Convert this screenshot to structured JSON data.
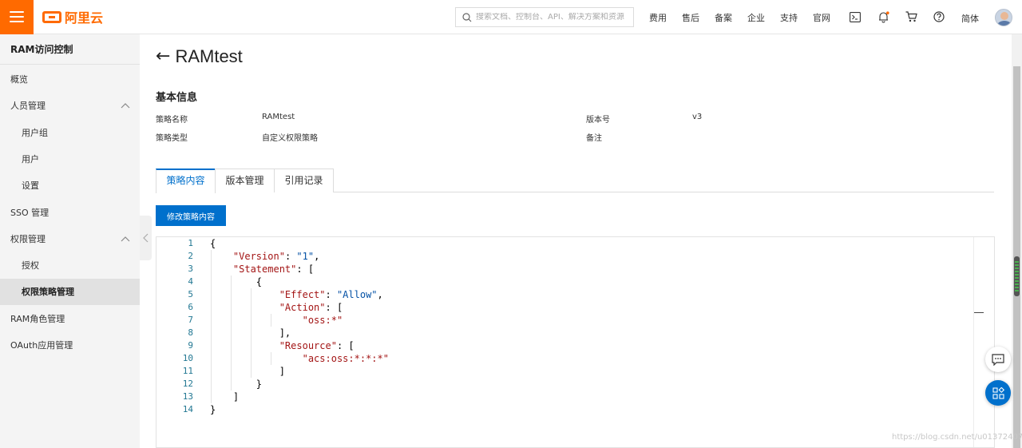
{
  "brand": {
    "name": "阿里云"
  },
  "topbar": {
    "search_placeholder": "搜索文档、控制台、API、解决方案和资源",
    "nav": [
      "费用",
      "售后",
      "备案",
      "企业",
      "支持",
      "官网"
    ],
    "lang": "简体"
  },
  "sidebar": {
    "title": "RAM访问控制",
    "items": [
      {
        "label": "概览"
      },
      {
        "label": "人员管理"
      },
      {
        "label": "用户组"
      },
      {
        "label": "用户"
      },
      {
        "label": "设置"
      },
      {
        "label": "SSO 管理"
      },
      {
        "label": "权限管理"
      },
      {
        "label": "授权"
      },
      {
        "label": "权限策略管理"
      },
      {
        "label": "RAM角色管理"
      },
      {
        "label": "OAuth应用管理"
      }
    ]
  },
  "page": {
    "title": "RAMtest",
    "section_title": "基本信息",
    "info": {
      "policy_name_label": "策略名称",
      "policy_name": "RAMtest",
      "version_label": "版本号",
      "version": "v3",
      "policy_type_label": "策略类型",
      "policy_type": "自定义权限策略",
      "note_label": "备注"
    },
    "tabs": [
      "策略内容",
      "版本管理",
      "引用记录"
    ],
    "edit_button": "修改策略内容"
  },
  "code": {
    "line_numbers": [
      "1",
      "2",
      "3",
      "4",
      "5",
      "6",
      "7",
      "8",
      "9",
      "10",
      "11",
      "12",
      "13",
      "14"
    ],
    "k_version": "\"Version\"",
    "v_version": "\"1\"",
    "k_statement": "\"Statement\"",
    "k_effect": "\"Effect\"",
    "v_effect": "\"Allow\"",
    "k_action": "\"Action\"",
    "v_action": "\"oss:*\"",
    "k_resource": "\"Resource\"",
    "v_resource": "\"acs:oss:*:*:*\""
  },
  "watermark": "https://blog.csdn.net/u013724076"
}
